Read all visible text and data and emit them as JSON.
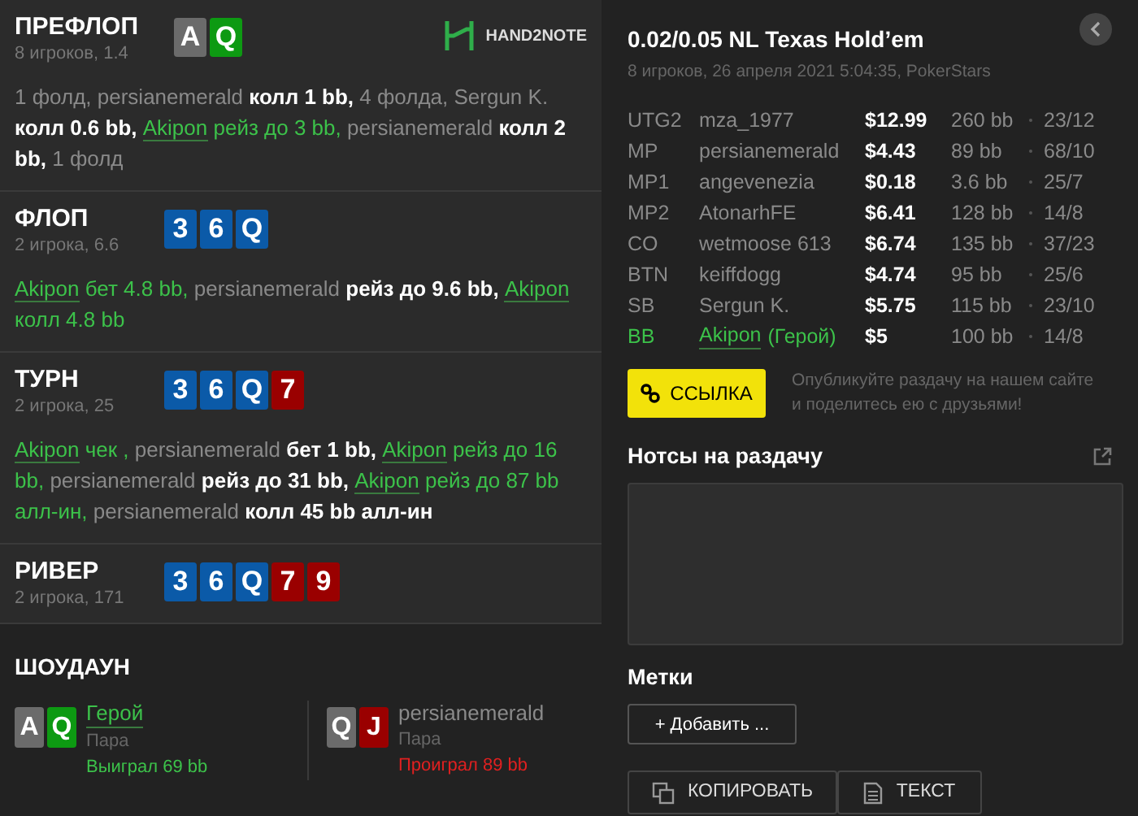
{
  "streets": [
    {
      "name": "ПРЕФЛОП",
      "info": "8 игроков, 1.4",
      "cards": [
        {
          "rank": "A",
          "color": "#6b6b6b"
        },
        {
          "rank": "Q",
          "color": "#0d9a12"
        }
      ],
      "actions": [
        {
          "text": "1 фолд, ",
          "kind": "muted"
        },
        {
          "text": "persianemerald ",
          "kind": "muted"
        },
        {
          "text": "колл 1 bb, ",
          "kind": "action"
        },
        {
          "text": "4 фолда, Sergun K. ",
          "kind": "muted"
        },
        {
          "text": "колл 0.6 bb, ",
          "kind": "action"
        },
        {
          "text": "Akipon",
          "kind": "hero"
        },
        {
          "text": " рейз до 3 bb, ",
          "kind": "hero_action"
        },
        {
          "text": "persianemerald ",
          "kind": "muted"
        },
        {
          "text": "колл 2 bb, ",
          "kind": "action"
        },
        {
          "text": "1 фолд",
          "kind": "muted"
        }
      ]
    },
    {
      "name": "ФЛОП",
      "info": "2 игрока, 6.6",
      "cards": [
        {
          "rank": "3",
          "color": "#0b5aa8"
        },
        {
          "rank": "6",
          "color": "#0b5aa8"
        },
        {
          "rank": "Q",
          "color": "#0b5aa8"
        }
      ],
      "actions": [
        {
          "text": "Akipon",
          "kind": "hero"
        },
        {
          "text": " бет 4.8 bb, ",
          "kind": "hero_action"
        },
        {
          "text": "persianemerald ",
          "kind": "muted"
        },
        {
          "text": "рейз до 9.6 bb, ",
          "kind": "action"
        },
        {
          "text": "Akipon",
          "kind": "hero"
        },
        {
          "text": " колл 4.8 bb",
          "kind": "hero_action"
        }
      ]
    },
    {
      "name": "ТУРН",
      "info": "2 игрока, 25",
      "cards": [
        {
          "rank": "3",
          "color": "#0b5aa8"
        },
        {
          "rank": "6",
          "color": "#0b5aa8"
        },
        {
          "rank": "Q",
          "color": "#0b5aa8"
        },
        {
          "rank": "7",
          "color": "#9a0000"
        }
      ],
      "actions": [
        {
          "text": "Akipon",
          "kind": "hero"
        },
        {
          "text": " чек , ",
          "kind": "hero_action"
        },
        {
          "text": "persianemerald ",
          "kind": "muted"
        },
        {
          "text": "бет 1 bb, ",
          "kind": "action"
        },
        {
          "text": "Akipon",
          "kind": "hero"
        },
        {
          "text": " рейз до 16 bb, ",
          "kind": "hero_action"
        },
        {
          "text": "persianemerald ",
          "kind": "muted"
        },
        {
          "text": "рейз до 31 bb, ",
          "kind": "action"
        },
        {
          "text": "Akipon",
          "kind": "hero"
        },
        {
          "text": " рейз до 87 bb алл-ин, ",
          "kind": "hero_action"
        },
        {
          "text": "persianemerald ",
          "kind": "muted"
        },
        {
          "text": "колл 45 bb алл-ин",
          "kind": "action"
        }
      ]
    },
    {
      "name": "РИВЕР",
      "info": "2 игрока, 171",
      "cards": [
        {
          "rank": "3",
          "color": "#0b5aa8"
        },
        {
          "rank": "6",
          "color": "#0b5aa8"
        },
        {
          "rank": "Q",
          "color": "#0b5aa8"
        },
        {
          "rank": "7",
          "color": "#9a0000"
        },
        {
          "rank": "9",
          "color": "#9a0000"
        }
      ]
    }
  ],
  "logo": {
    "text": "HAND2NOTE"
  },
  "showdown": {
    "title": "ШОУДАУН",
    "players": [
      {
        "name": "Герой",
        "hero": true,
        "hand": "Пара",
        "result": "Выиграл 69 bb",
        "won": true,
        "cards": [
          {
            "rank": "A",
            "color": "#6b6b6b"
          },
          {
            "rank": "Q",
            "color": "#0d9a12"
          }
        ]
      },
      {
        "name": "persianemerald",
        "hero": false,
        "hand": "Пара",
        "result": "Проиграл 89 bb",
        "won": false,
        "cards": [
          {
            "rank": "Q",
            "color": "#6b6b6b"
          },
          {
            "rank": "J",
            "color": "#9a0000"
          }
        ]
      }
    ]
  },
  "game": {
    "title": "0.02/0.05 NL Texas Hold’em",
    "info": "8 игроков, 26 апреля 2021 5:04:35, PokerStars"
  },
  "players": [
    {
      "position": "UTG2",
      "name": "mza_1977",
      "stack": "$12.99",
      "bb": "260 bb",
      "stats": "23/12",
      "hero": false
    },
    {
      "position": "MP",
      "name": "persianemerald",
      "stack": "$4.43",
      "bb": "89 bb",
      "stats": "68/10",
      "hero": false
    },
    {
      "position": "MP1",
      "name": "angevenezia",
      "stack": "$0.18",
      "bb": "3.6 bb",
      "stats": "25/7",
      "hero": false
    },
    {
      "position": "MP2",
      "name": "AtonarhFE",
      "stack": "$6.41",
      "bb": "128 bb",
      "stats": "14/8",
      "hero": false
    },
    {
      "position": "CO",
      "name": "wetmoose 613",
      "stack": "$6.74",
      "bb": "135 bb",
      "stats": "37/23",
      "hero": false
    },
    {
      "position": "BTN",
      "name": "keiffdogg",
      "stack": "$4.74",
      "bb": "95 bb",
      "stats": "25/6",
      "hero": false
    },
    {
      "position": "SB",
      "name": "Sergun K.",
      "stack": "$5.75",
      "bb": "115 bb",
      "stats": "23/10",
      "hero": false
    },
    {
      "position": "BB",
      "name": "Akipon",
      "note": "(Герой)",
      "stack": "$5",
      "bb": "100 bb",
      "stats": "14/8",
      "hero": true
    }
  ],
  "link_button": "ССЫЛКА",
  "share_text": "Опубликуйте раздачу на нашем сайте и поделитесь ею с друзьями!",
  "notes": {
    "title": "Нотсы на раздачу"
  },
  "tags": {
    "title": "Метки",
    "add_button": "+ Добавить ..."
  },
  "buttons": [
    {
      "label": "КОПИРОВАТЬ",
      "kind": "copy"
    },
    {
      "label": "ТЕКСТ",
      "kind": "text"
    }
  ]
}
